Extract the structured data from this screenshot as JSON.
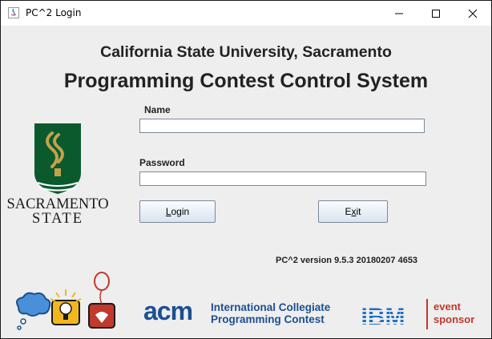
{
  "window": {
    "title": "PC^2 Login",
    "controls": [
      "minimize-icon",
      "maximize-icon",
      "close-icon"
    ]
  },
  "header": {
    "university": "California State University, Sacramento",
    "system": "Programming Contest Control System"
  },
  "logo": {
    "line1": "SACRAMENTO",
    "line2": "STATE",
    "colors": {
      "green": "#0a5a2e",
      "gold": "#c4a24a"
    }
  },
  "form": {
    "name_label": "Name",
    "name_value": "",
    "password_label": "Password",
    "password_value": ""
  },
  "buttons": {
    "login": {
      "mnemonic": "L",
      "rest": "ogin"
    },
    "exit": {
      "pre": "E",
      "mnemonic": "x",
      "rest": "it"
    }
  },
  "version": "PC^2 version 9.5.3 20180207 4653",
  "footer": {
    "acm": "acm",
    "icpc_line1": "International Collegiate",
    "icpc_line2": "Programming Contest",
    "ibm": "IBM",
    "sponsor_line1": "event",
    "sponsor_line2": "sponsor",
    "colors": {
      "acm_blue": "#1d4f91",
      "ibm_blue": "#1f70c1",
      "sponsor_red": "#c0392b"
    }
  }
}
